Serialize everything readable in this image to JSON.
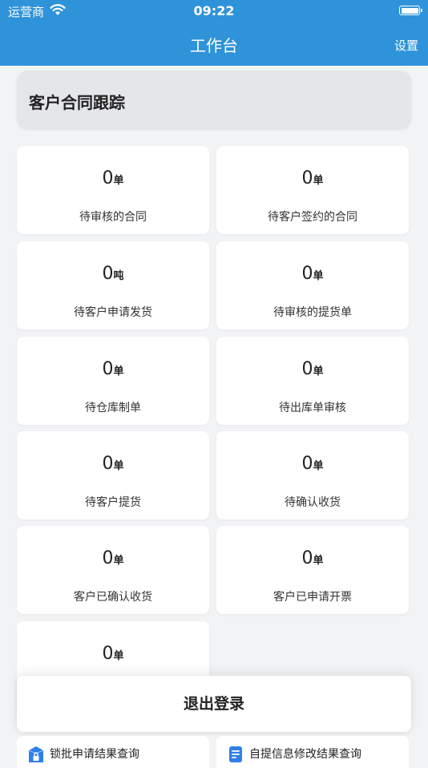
{
  "status_bar": {
    "carrier": "运营商",
    "time": "09:22"
  },
  "nav": {
    "title": "工作台",
    "settings": "设置"
  },
  "section": {
    "title": "客户合同跟踪"
  },
  "cards": [
    {
      "value": "0",
      "unit": "单",
      "label": "待审核的合同"
    },
    {
      "value": "0",
      "unit": "单",
      "label": "待客户签约的合同"
    },
    {
      "value": "0",
      "unit": "吨",
      "label": "待客户申请发货"
    },
    {
      "value": "0",
      "unit": "单",
      "label": "待审核的提货单"
    },
    {
      "value": "0",
      "unit": "单",
      "label": "待仓库制单"
    },
    {
      "value": "0",
      "unit": "单",
      "label": "待出库单审核"
    },
    {
      "value": "0",
      "unit": "单",
      "label": "待客户提货"
    },
    {
      "value": "0",
      "unit": "单",
      "label": "待确认收货"
    },
    {
      "value": "0",
      "unit": "单",
      "label": "客户已确认收货"
    },
    {
      "value": "0",
      "unit": "单",
      "label": "客户已申请开票"
    },
    {
      "value": "0",
      "unit": "单",
      "label": ""
    }
  ],
  "logout": {
    "label": "退出登录"
  },
  "bottom_items": [
    {
      "label": "锁批申请结果查询",
      "icon": "lock-box-icon",
      "color": "#2f7fe8"
    },
    {
      "label": "自提信息修改结果查询",
      "icon": "document-icon",
      "color": "#2f7fe8"
    }
  ]
}
